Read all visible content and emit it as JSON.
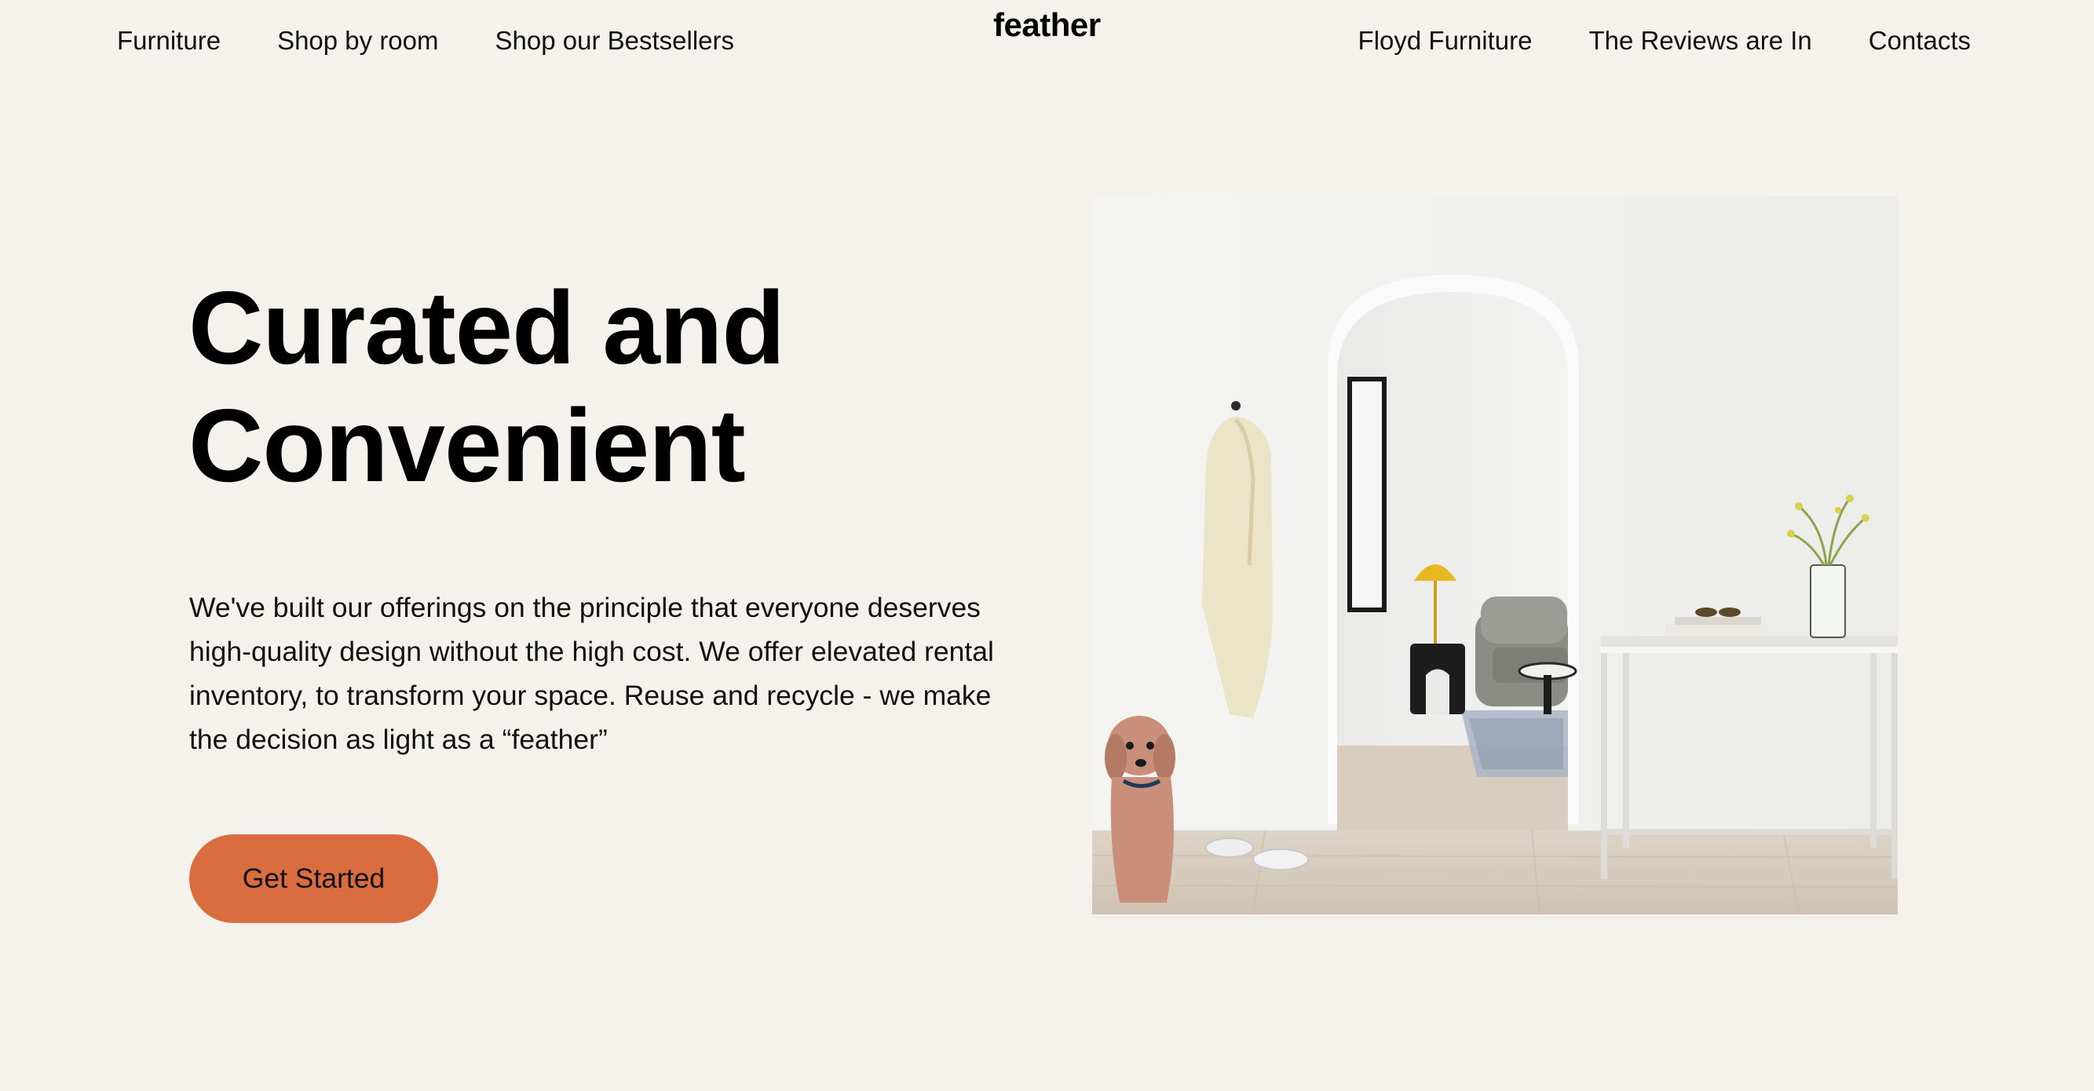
{
  "header": {
    "logo": "feather",
    "nav_left": [
      {
        "label": "Furniture"
      },
      {
        "label": "Shop by room"
      },
      {
        "label": "Shop our Bestsellers"
      }
    ],
    "nav_right": [
      {
        "label": "Floyd Furniture"
      },
      {
        "label": "The Reviews are In"
      },
      {
        "label": "Contacts"
      }
    ]
  },
  "hero": {
    "title_line1": "Curated and",
    "title_line2": "Convenient",
    "description": "We've built our offerings on the principle that everyone deserves high-quality design without the high cost. We offer elevated rental inventory, to transform your space. Reuse and recycle - we make the decision as light as a “feather”",
    "cta_label": "Get Started"
  },
  "colors": {
    "background": "#f5f2ed",
    "cta": "#d96d3f",
    "text": "#0a0a0a"
  }
}
